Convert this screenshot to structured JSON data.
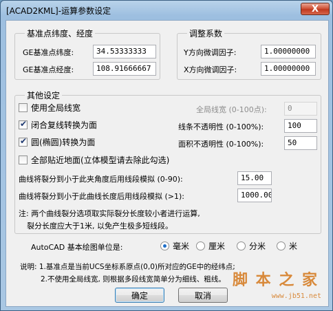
{
  "window": {
    "title": "[ACAD2KML]-运算参数设定",
    "close_glyph": "X"
  },
  "coords_group": {
    "legend": "基准点纬度、经度",
    "lat_label": "GE基准点纬度:",
    "lat_value": "34.53333333",
    "lon_label": "GE基准点经度:",
    "lon_value": "108.91666667"
  },
  "adjust_group": {
    "legend": "调整系数",
    "y_label": "Y方向微调因子:",
    "y_value": "1.00000000",
    "x_label": "X方向微调因子:",
    "x_value": "1.00000000"
  },
  "other_group": {
    "legend": "其他设定",
    "use_global_width": {
      "label": "使用全局线宽",
      "checked": false
    },
    "global_width_label": "全局线宽 (0-100点):",
    "global_width_value": "0",
    "closed_polyline": {
      "label": "闭合复线转换为面",
      "checked": true
    },
    "line_opacity_label": "线条不透明性 (0-100%):",
    "line_opacity_value": "100",
    "circle_to_face": {
      "label": "圆(椭圆)转换为面",
      "checked": true
    },
    "face_opacity_label": "面积不透明性 (0-100%):",
    "face_opacity_value": "50",
    "clamp_ground": {
      "label": "全部贴近地面(立体模型请去除此勾选)",
      "checked": false
    },
    "angle_label": "曲线将裂分到小于此夹角度后用线段模拟 (0-90):",
    "angle_value": "15.00",
    "length_label": "曲线将裂分到小于此曲线长度后用线段模拟 (>1):",
    "length_value": "1000.00",
    "note_line1": "注: 两个曲线裂分选项取实际裂分长度较小者进行运算,",
    "note_line2": "裂分长度应大于1米, 以免产生极多短线段。"
  },
  "units": {
    "label": "AutoCAD 基本绘图单位是:",
    "options": [
      "毫米",
      "厘米",
      "分米",
      "米"
    ],
    "selected": "毫米"
  },
  "notes": {
    "line1": "说明: 1.基准点是当前UCS坐标系原点(0,0)所对应的GE中的经纬点;",
    "line2": "2.不使用全局线宽, 则根据多段线宽简单分为细线、粗线。"
  },
  "buttons": {
    "ok": "确定",
    "cancel": "取消"
  },
  "watermark": {
    "big": "脚 本 之 家",
    "small": "www.jb51.net"
  }
}
